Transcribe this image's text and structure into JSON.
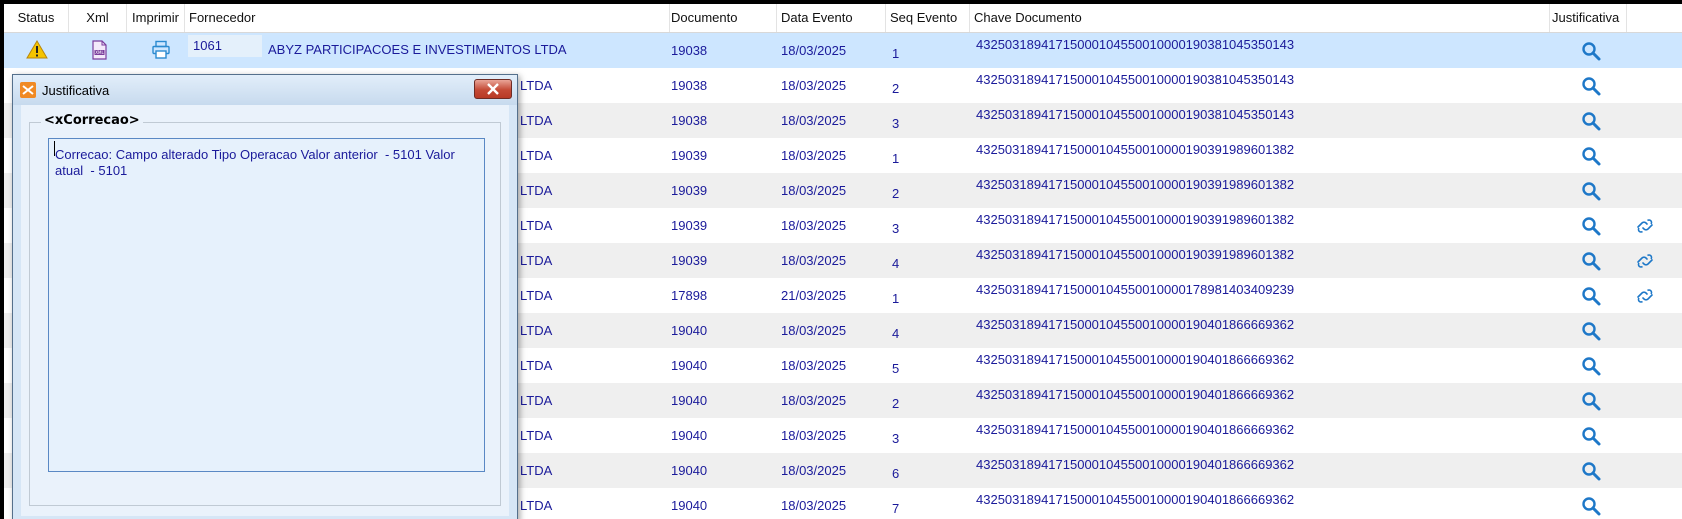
{
  "grid": {
    "columns": {
      "status": "Status",
      "xml": "Xml",
      "imprimir": "Imprimir",
      "fornecedor": "Fornecedor",
      "documento": "Documento",
      "data_evento": "Data Evento",
      "seq_evento": "Seq Evento",
      "chave_documento": "Chave Documento",
      "justificativa": "Justificativa"
    },
    "rows": [
      {
        "codigo": "1061",
        "fornecedor": "ABYZ PARTICIPACOES E INVESTIMENTOS LTDA",
        "documento": "19038",
        "data": "18/03/2025",
        "seq": "1",
        "chave": "43250318941715000104550010000190381045350143",
        "link": false
      },
      {
        "fornecedor": "LTDA",
        "documento": "19038",
        "data": "18/03/2025",
        "seq": "2",
        "chave": "43250318941715000104550010000190381045350143",
        "link": false
      },
      {
        "fornecedor": "LTDA",
        "documento": "19038",
        "data": "18/03/2025",
        "seq": "3",
        "chave": "43250318941715000104550010000190381045350143",
        "link": false
      },
      {
        "fornecedor": "LTDA",
        "documento": "19039",
        "data": "18/03/2025",
        "seq": "1",
        "chave": "43250318941715000104550010000190391989601382",
        "link": false
      },
      {
        "fornecedor": "LTDA",
        "documento": "19039",
        "data": "18/03/2025",
        "seq": "2",
        "chave": "43250318941715000104550010000190391989601382",
        "link": false
      },
      {
        "fornecedor": "LTDA",
        "documento": "19039",
        "data": "18/03/2025",
        "seq": "3",
        "chave": "43250318941715000104550010000190391989601382",
        "link": true
      },
      {
        "fornecedor": "LTDA",
        "documento": "19039",
        "data": "18/03/2025",
        "seq": "4",
        "chave": "43250318941715000104550010000190391989601382",
        "link": true
      },
      {
        "fornecedor": "LTDA",
        "documento": "17898",
        "data": "21/03/2025",
        "seq": "1",
        "chave": "43250318941715000104550010000178981403409239",
        "link": true
      },
      {
        "fornecedor": "LTDA",
        "documento": "19040",
        "data": "18/03/2025",
        "seq": "4",
        "chave": "43250318941715000104550010000190401866669362",
        "link": false
      },
      {
        "fornecedor": "LTDA",
        "documento": "19040",
        "data": "18/03/2025",
        "seq": "5",
        "chave": "43250318941715000104550010000190401866669362",
        "link": false
      },
      {
        "fornecedor": "LTDA",
        "documento": "19040",
        "data": "18/03/2025",
        "seq": "2",
        "chave": "43250318941715000104550010000190401866669362",
        "link": false
      },
      {
        "fornecedor": "LTDA",
        "documento": "19040",
        "data": "18/03/2025",
        "seq": "3",
        "chave": "43250318941715000104550010000190401866669362",
        "link": false
      },
      {
        "fornecedor": "LTDA",
        "documento": "19040",
        "data": "18/03/2025",
        "seq": "6",
        "chave": "43250318941715000104550010000190401866669362",
        "link": false
      },
      {
        "fornecedor": "LTDA",
        "documento": "19040",
        "data": "18/03/2025",
        "seq": "7",
        "chave": "43250318941715000104550010000190401866669362",
        "link": false
      }
    ],
    "icons": {
      "status": "warning-icon",
      "xml": "xml-file-icon",
      "imprimir": "printer-icon",
      "justificativa": "search-icon",
      "extra": "link-icon"
    }
  },
  "dialog": {
    "title": "Justificativa",
    "group_caption": "<xCorrecao>",
    "text": "Correcao: Campo alterado Tipo Operacao Valor anterior  - 5101 Valor\natual  - 5101",
    "close_icon": "close-icon",
    "app_icon": "app-icon"
  },
  "colors": {
    "selected_row": "#cde6ff",
    "alt_row": "#efefef",
    "text": "#1a1a9a"
  }
}
